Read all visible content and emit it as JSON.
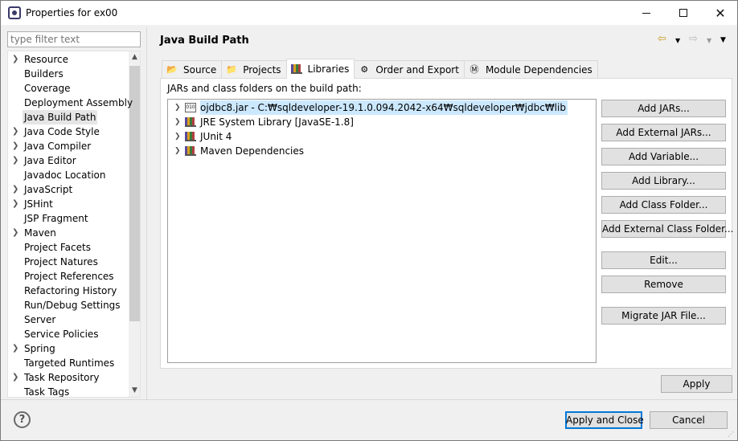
{
  "window": {
    "title": "Properties for ex00",
    "minimize_icon": "minimize-icon",
    "maximize_icon": "maximize-icon",
    "close_icon": "close-icon",
    "close_glyph": "✕"
  },
  "filter": {
    "placeholder": "type filter text",
    "value": ""
  },
  "nav": {
    "items": [
      {
        "label": "Resource",
        "expandable": true
      },
      {
        "label": "Builders",
        "expandable": false
      },
      {
        "label": "Coverage",
        "expandable": false
      },
      {
        "label": "Deployment Assembly",
        "expandable": false
      },
      {
        "label": "Java Build Path",
        "expandable": false,
        "selected": true
      },
      {
        "label": "Java Code Style",
        "expandable": true
      },
      {
        "label": "Java Compiler",
        "expandable": true
      },
      {
        "label": "Java Editor",
        "expandable": true
      },
      {
        "label": "Javadoc Location",
        "expandable": false
      },
      {
        "label": "JavaScript",
        "expandable": true
      },
      {
        "label": "JSHint",
        "expandable": true
      },
      {
        "label": "JSP Fragment",
        "expandable": false
      },
      {
        "label": "Maven",
        "expandable": true
      },
      {
        "label": "Project Facets",
        "expandable": false
      },
      {
        "label": "Project Natures",
        "expandable": false
      },
      {
        "label": "Project References",
        "expandable": false
      },
      {
        "label": "Refactoring History",
        "expandable": false
      },
      {
        "label": "Run/Debug Settings",
        "expandable": false
      },
      {
        "label": "Server",
        "expandable": false
      },
      {
        "label": "Service Policies",
        "expandable": false
      },
      {
        "label": "Spring",
        "expandable": true
      },
      {
        "label": "Targeted Runtimes",
        "expandable": false
      },
      {
        "label": "Task Repository",
        "expandable": true
      },
      {
        "label": "Task Tags",
        "expandable": false
      }
    ]
  },
  "page": {
    "title": "Java Build Path"
  },
  "tabs": [
    {
      "label": "Source",
      "icon": "source-folder-icon",
      "active": false
    },
    {
      "label": "Projects",
      "icon": "projects-icon",
      "active": false
    },
    {
      "label": "Libraries",
      "icon": "libraries-icon",
      "active": true
    },
    {
      "label": "Order and Export",
      "icon": "order-export-icon",
      "active": false
    },
    {
      "label": "Module Dependencies",
      "icon": "module-dependencies-icon",
      "active": false
    }
  ],
  "libraries": {
    "label": "JARs and class folders on the build path:",
    "entries": [
      {
        "label": "ojdbc8.jar - C:₩sqldeveloper-19.1.0.094.2042-x64₩sqldeveloper₩jdbc₩lib",
        "icon": "jar-icon",
        "selected": true
      },
      {
        "label": "JRE System Library [JavaSE-1.8]",
        "icon": "library-icon",
        "selected": false
      },
      {
        "label": "JUnit 4",
        "icon": "library-icon",
        "selected": false
      },
      {
        "label": "Maven Dependencies",
        "icon": "library-icon",
        "selected": false
      }
    ],
    "buttons": {
      "add_jars": "Add JARs...",
      "add_external_jars": "Add External JARs...",
      "add_variable": "Add Variable...",
      "add_library": "Add Library...",
      "add_class_folder": "Add Class Folder...",
      "add_external_class_folder": "Add External Class Folder...",
      "edit": "Edit...",
      "remove": "Remove",
      "migrate_jar": "Migrate JAR File..."
    }
  },
  "footer": {
    "apply": "Apply",
    "apply_and_close": "Apply and Close",
    "cancel": "Cancel",
    "help_glyph": "?"
  }
}
